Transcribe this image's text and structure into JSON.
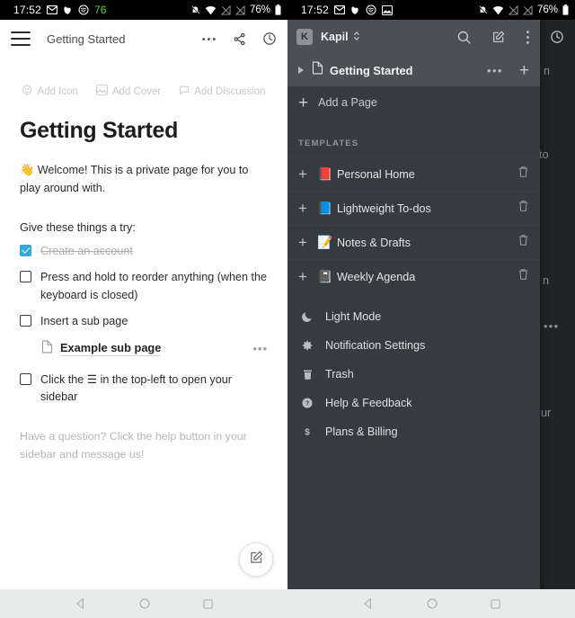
{
  "left": {
    "statusbar": {
      "time": "17:52",
      "icons": [
        "gmail-icon",
        "pocket-icon",
        "spotify-icon"
      ],
      "badge_number": "76",
      "right_icons": [
        "notifications-off-icon",
        "wifi-icon",
        "signal-off-icon",
        "signal-off-2-icon"
      ],
      "battery_percent": "76%"
    },
    "appbar": {
      "menu_icon": "hamburger-icon",
      "title": "Getting Started",
      "actions": [
        "more-horizontal-icon",
        "share-icon",
        "history-icon"
      ]
    },
    "page_actions": [
      {
        "icon": "emoji-icon",
        "label": "Add Icon"
      },
      {
        "icon": "image-icon",
        "label": "Add Cover"
      },
      {
        "icon": "comment-icon",
        "label": "Add Discussion"
      }
    ],
    "document": {
      "title": "Getting Started",
      "intro_emoji": "👋",
      "intro": "Welcome! This is a private page for you to play around with.",
      "prompt": "Give these things a try:",
      "todos": [
        {
          "checked": true,
          "text": "Create an account"
        },
        {
          "checked": false,
          "text": "Press and hold to reorder anything (when the keyboard is closed)"
        },
        {
          "checked": false,
          "text": "Insert a sub page"
        }
      ],
      "subpage": {
        "icon": "page-icon",
        "name": "Example sub page",
        "more": "•••"
      },
      "todo_last": {
        "checked": false,
        "text": "Click the ☰ in the top-left to open your sidebar"
      },
      "help": "Have a question? Click the help button in your sidebar and message us!"
    },
    "fab": {
      "icon": "compose-icon"
    }
  },
  "right": {
    "statusbar": {
      "time": "17:52",
      "icons": [
        "gmail-icon",
        "pocket-icon",
        "spotify-icon",
        "screenshot-icon"
      ],
      "right_icons": [
        "notifications-off-icon",
        "wifi-icon",
        "signal-off-icon",
        "signal-off-2-icon"
      ],
      "battery_percent": "76%"
    },
    "drawer": {
      "account": {
        "initial": "K",
        "name": "Kapil",
        "sort_icon": "sort-toggle-icon"
      },
      "actions": [
        "search-icon",
        "compose-icon",
        "more-vertical-icon",
        "history-icon"
      ],
      "active_page": {
        "caret": "caret-right-icon",
        "icon": "page-icon",
        "label": "Getting Started",
        "more": "•••",
        "add": "+"
      },
      "add_page": {
        "icon": "plus-icon",
        "label": "Add a Page"
      },
      "templates_title": "TEMPLATES",
      "templates": [
        {
          "add": "+",
          "emoji": "📕",
          "label": "Personal Home",
          "delete_icon": "trash-icon"
        },
        {
          "add": "+",
          "emoji": "📘",
          "label": "Lightweight To-dos",
          "delete_icon": "trash-icon"
        },
        {
          "add": "+",
          "emoji": "📝",
          "label": "Notes & Drafts",
          "delete_icon": "trash-icon"
        },
        {
          "add": "+",
          "emoji": "📓",
          "label": "Weekly Agenda",
          "delete_icon": "trash-icon"
        }
      ],
      "menu": [
        {
          "icon": "moon-icon",
          "label": "Light Mode"
        },
        {
          "icon": "gear-icon",
          "label": "Notification Settings"
        },
        {
          "icon": "trash-icon",
          "label": "Trash"
        },
        {
          "icon": "help-icon",
          "label": "Help & Feedback"
        },
        {
          "icon": "dollar-icon",
          "label": "Plans & Billing"
        }
      ]
    },
    "behind": {
      "f1": "n",
      "f2": "to",
      "f3": "n",
      "f4": "•••",
      "f5": "ur"
    }
  },
  "navbar": {
    "back": "back-icon",
    "home": "home-icon",
    "recents": "recents-icon"
  },
  "colors": {
    "accent": "#2eaadc",
    "drawer_bg": "#353b3e",
    "drawer_head": "#4a5054",
    "scrim": "#1f2427",
    "battery_green": "#57d12d"
  }
}
